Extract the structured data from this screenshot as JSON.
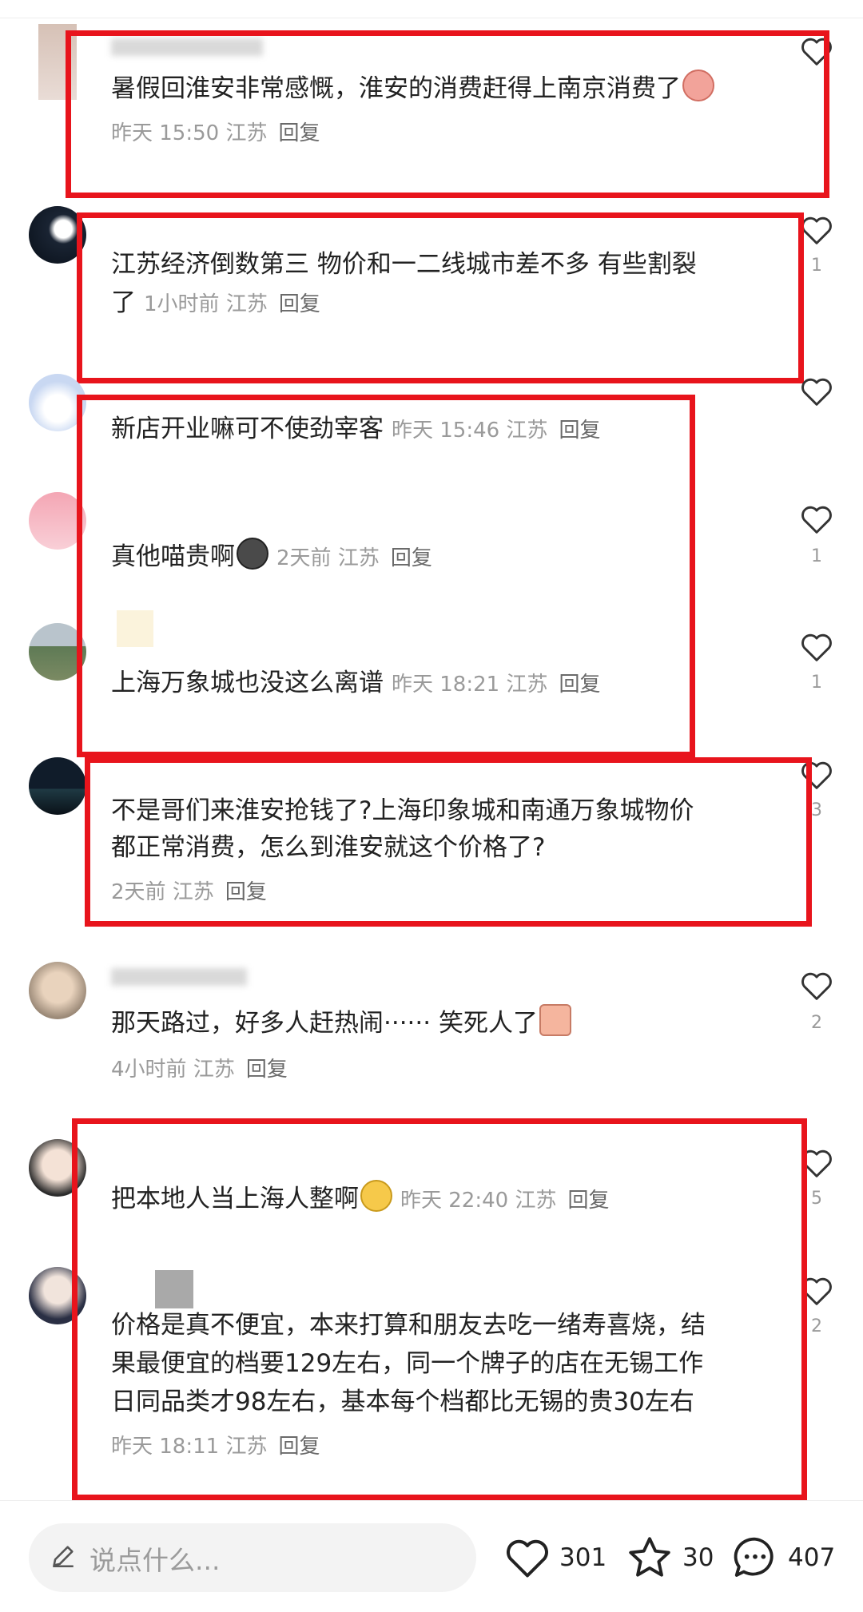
{
  "comments": [
    {
      "text": "暑假回淮安非常感慨，淮安的消费赶得上南京消费了",
      "time": "昨天 15:50",
      "location": "江苏",
      "reply": "回复",
      "likes": ""
    },
    {
      "text_line1": "江苏经济倒数第三 物价和一二线城市差不多 有些割裂",
      "text_line2": "了",
      "time": "1小时前",
      "location": "江苏",
      "reply": "回复",
      "likes": "1"
    },
    {
      "text": "新店开业嘛可不使劲宰客",
      "time": "昨天 15:46",
      "location": "江苏",
      "reply": "回复",
      "likes": ""
    },
    {
      "text": "真他喵贵啊",
      "time": "2天前",
      "location": "江苏",
      "reply": "回复",
      "likes": "1"
    },
    {
      "text": "上海万象城也没这么离谱",
      "time": "昨天 18:21",
      "location": "江苏",
      "reply": "回复",
      "likes": "1"
    },
    {
      "text_line1": "不是哥们来淮安抢钱了?上海印象城和南通万象城物价",
      "text_line2": "都正常消费，怎么到淮安就这个价格了?",
      "time": "2天前",
      "location": "江苏",
      "reply": "回复",
      "likes": "3"
    },
    {
      "text": "那天路过，好多人赶热闹······  笑死人了",
      "time": "4小时前",
      "location": "江苏",
      "reply": "回复",
      "likes": "2"
    },
    {
      "text": "把本地人当上海人整啊",
      "time": "昨天 22:40",
      "location": "江苏",
      "reply": "回复",
      "likes": "5"
    },
    {
      "text_line1": "价格是真不便宜，本来打算和朋友去吃一绪寿喜烧，结",
      "text_line2": "果最便宜的档要129左右，同一个牌子的店在无锡工作",
      "text_line3": "日同品类才98左右，基本每个档都比无锡的贵30左右",
      "time": "昨天 18:11",
      "location": "江苏",
      "reply": "回复",
      "likes": "2"
    }
  ],
  "bottom_bar": {
    "placeholder": "说点什么...",
    "like_count": "301",
    "star_count": "30",
    "comment_count": "407"
  },
  "colors": {
    "highlight_border": "#e8141c",
    "meta_text": "#9a9a9a"
  }
}
